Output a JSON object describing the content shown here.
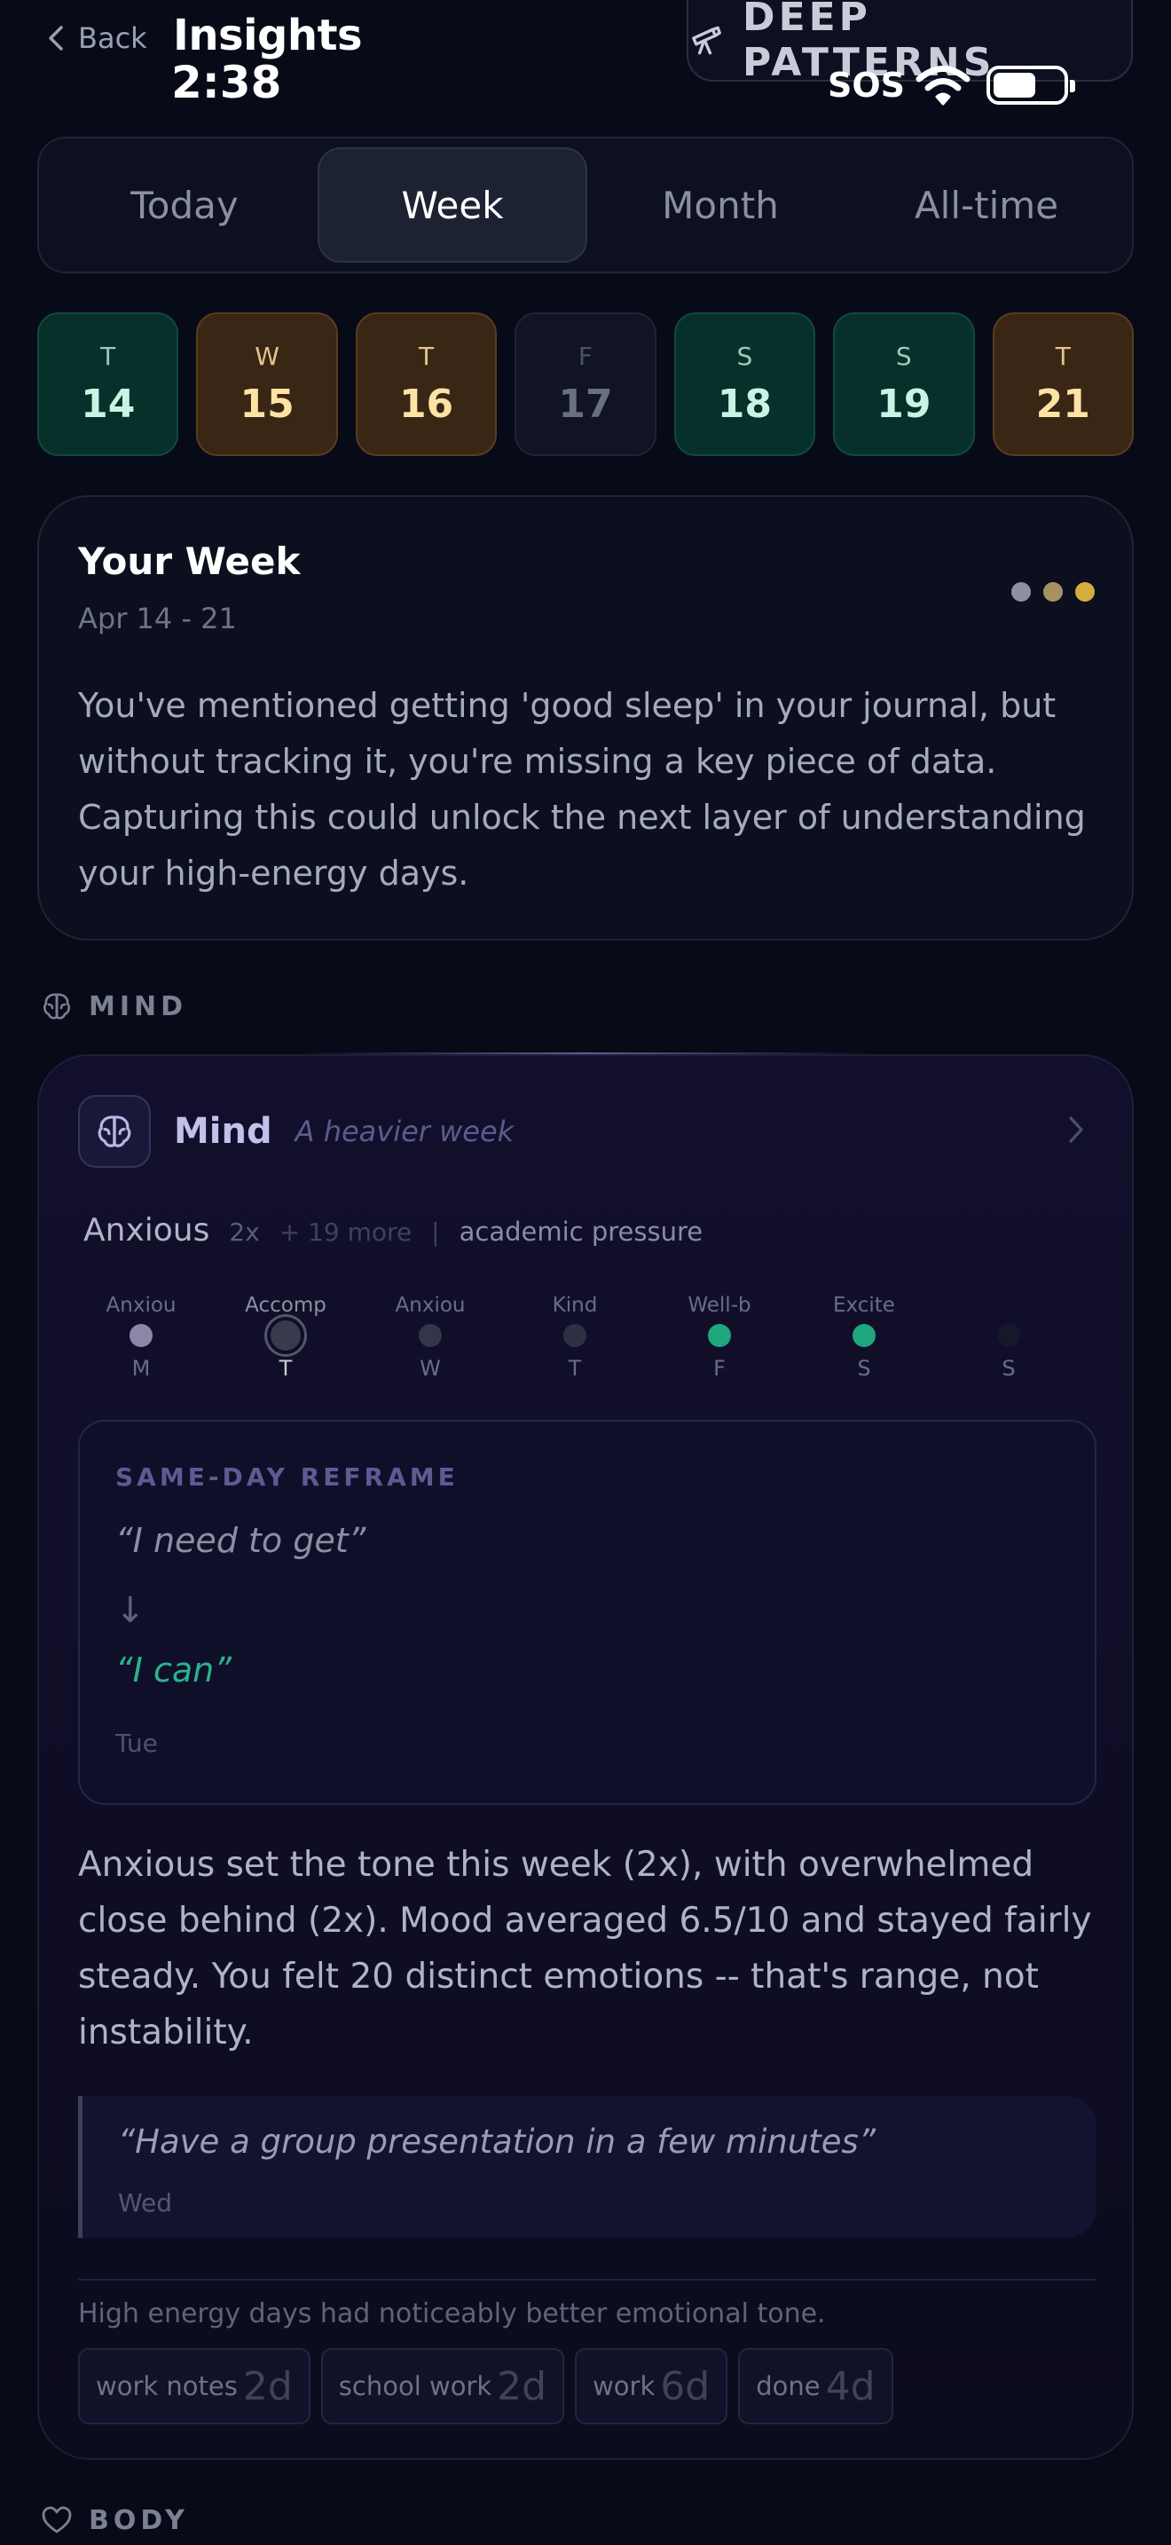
{
  "header": {
    "back_label": "Back",
    "title": "Insights",
    "clock": "2:38",
    "deep_patterns_label": "DEEP PATTERNS",
    "status_sos": "SOS"
  },
  "segments": [
    "Today",
    "Week",
    "Month",
    "All-time"
  ],
  "active_segment": "Week",
  "days": [
    {
      "letter": "T",
      "num": "14",
      "tone": "teal"
    },
    {
      "letter": "W",
      "num": "15",
      "tone": "amber"
    },
    {
      "letter": "T",
      "num": "16",
      "tone": "amber"
    },
    {
      "letter": "F",
      "num": "17",
      "tone": "gray"
    },
    {
      "letter": "S",
      "num": "18",
      "tone": "teal"
    },
    {
      "letter": "S",
      "num": "19",
      "tone": "teal"
    },
    {
      "letter": "T",
      "num": "21",
      "tone": "amber"
    }
  ],
  "your_week": {
    "title": "Your Week",
    "range": "Apr 14 - 21",
    "dot_colors": [
      "#8e8fa3",
      "#a79163",
      "#d5ad3c"
    ],
    "text": "You've mentioned getting 'good sleep' in your journal, but without tracking it, you're missing a key piece of data. Capturing this could unlock the next layer of understanding your high-energy days."
  },
  "sections": {
    "mind_label": "MIND",
    "body_label": "BODY"
  },
  "mind_card": {
    "title": "Mind",
    "subtitle": "A heavier week",
    "top_emotion": "Anxious",
    "top_count": "2x",
    "more": "+ 19 more",
    "separator": "|",
    "theme": "academic pressure",
    "week_dots": [
      {
        "label": "Anxiou",
        "day": "M",
        "color": "#8a88a6",
        "selected": false
      },
      {
        "label": "Accomp",
        "day": "T",
        "color": "#3a3a4f",
        "selected": true
      },
      {
        "label": "Anxiou",
        "day": "W",
        "color": "#33354a",
        "selected": false
      },
      {
        "label": "Kind",
        "day": "T",
        "color": "#2e3044",
        "selected": false
      },
      {
        "label": "Well-b",
        "day": "F",
        "color": "#1ea77d",
        "selected": false
      },
      {
        "label": "Excite",
        "day": "S",
        "color": "#1ea77d",
        "selected": false
      },
      {
        "label": "",
        "day": "S",
        "color": "#16182a",
        "selected": false
      }
    ],
    "reframe": {
      "label": "SAME-DAY REFRAME",
      "from": "“I need to get”",
      "arrow": "↓",
      "to": "“I can”",
      "day": "Tue"
    },
    "summary": "Anxious set the tone this week (2x), with overwhelmed close behind (2x). Mood averaged 6.5/10 and stayed fairly steady. You felt 20 distinct emotions -- that's range, not instability.",
    "quote": {
      "text": "“Have a group presentation in a few minutes”",
      "day": "Wed"
    },
    "note": "High energy days had noticeably better emotional tone.",
    "chips": [
      {
        "label": "work notes",
        "value": "2d"
      },
      {
        "label": "school work",
        "value": "2d"
      },
      {
        "label": "work",
        "value": "6d"
      },
      {
        "label": "done",
        "value": "4d"
      }
    ]
  }
}
